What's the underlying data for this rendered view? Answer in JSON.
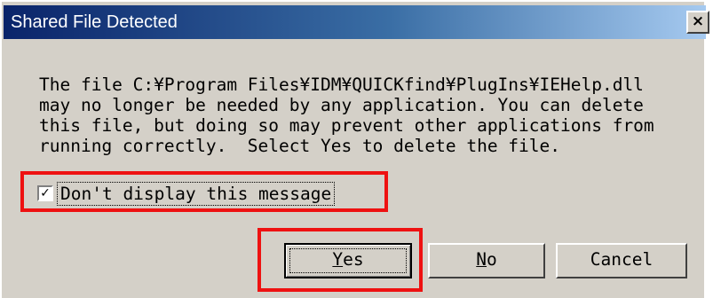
{
  "dialog": {
    "title": "Shared File Detected",
    "close_glyph": "×",
    "message_lines": [
      "The file C:¥Program Files¥IDM¥QUICKfind¥PlugIns¥IEHelp.dll",
      "may no longer be needed by any application. You can delete",
      "this file, but doing so may prevent other applications from",
      "running correctly.  Select Yes to delete the file."
    ],
    "checkbox": {
      "label": "Don't display this message",
      "checked": true,
      "check_glyph": "✓"
    },
    "buttons": {
      "yes": {
        "mnemonic": "Y",
        "rest": "es"
      },
      "no": {
        "mnemonic": "N",
        "rest": "o"
      },
      "cancel": {
        "label": "Cancel"
      }
    }
  },
  "annotations": {
    "highlight_color": "#ee1111"
  }
}
